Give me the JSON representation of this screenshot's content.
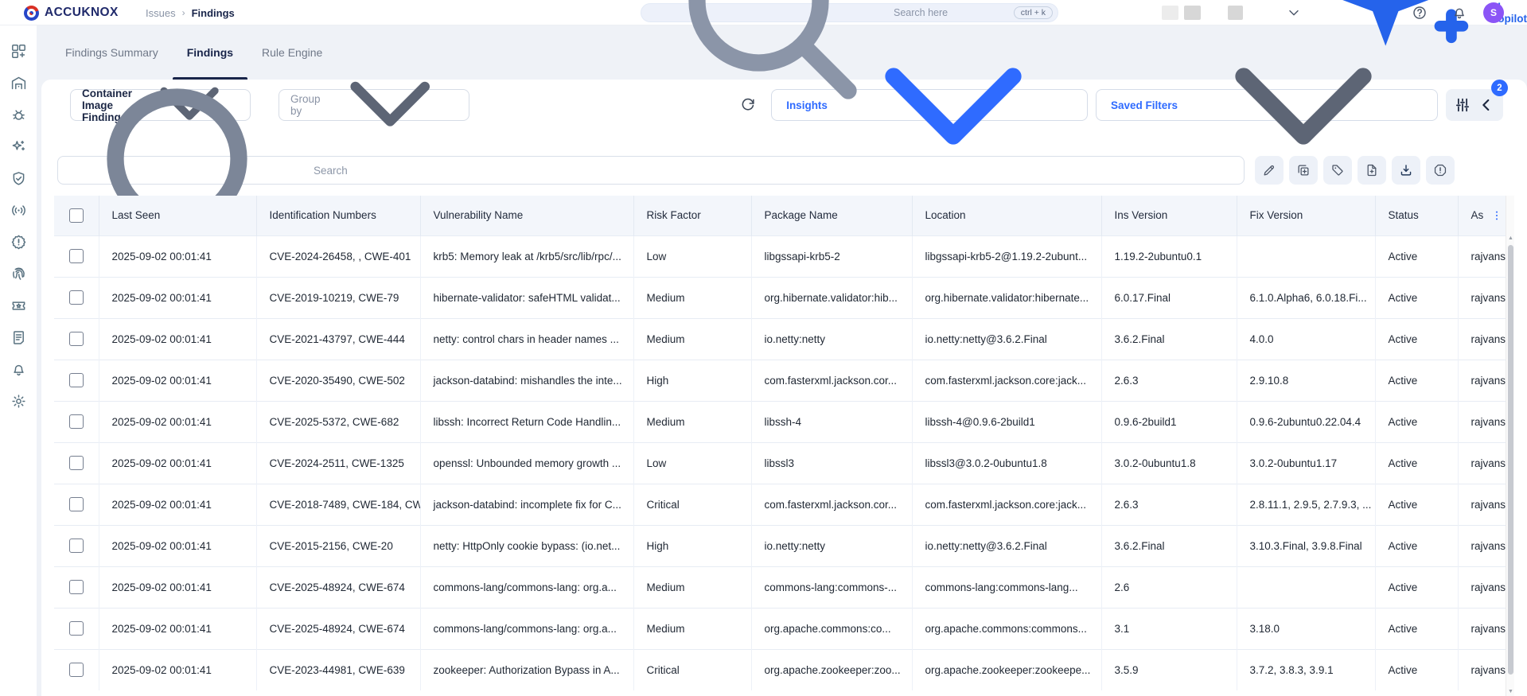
{
  "brand": {
    "name": "ACCUKNOX"
  },
  "topbar": {
    "breadcrumb": {
      "parent": "Issues",
      "separator": "›",
      "current": "Findings"
    },
    "search": {
      "placeholder": "Search here",
      "shortcut": "ctrl + k"
    },
    "copilot_label": "AI Copilot",
    "avatar_initial": "S"
  },
  "sidebar": {
    "items": [
      {
        "id": "dashboard",
        "icon": "dashboard-plus-icon"
      },
      {
        "id": "inventory",
        "icon": "warehouse-icon"
      },
      {
        "id": "issues",
        "icon": "bug-icon"
      },
      {
        "id": "remediation",
        "icon": "sparkles-icon"
      },
      {
        "id": "compliance",
        "icon": "shield-check-icon"
      },
      {
        "id": "runtime-protection",
        "icon": "broadcast-icon"
      },
      {
        "id": "alerts",
        "icon": "badge-alert-icon"
      },
      {
        "id": "identity",
        "icon": "fingerprint-icon"
      },
      {
        "id": "tickets",
        "icon": "ticket-star-icon"
      },
      {
        "id": "reports",
        "icon": "notebook-icon"
      },
      {
        "id": "notifications",
        "icon": "bell-icon"
      },
      {
        "id": "settings",
        "icon": "gear-icon"
      }
    ]
  },
  "tabs": [
    {
      "label": "Findings Summary",
      "active": false
    },
    {
      "label": "Findings",
      "active": true
    },
    {
      "label": "Rule Engine",
      "active": false
    }
  ],
  "filters": {
    "finding_type": "Container Image Findings",
    "group_by_placeholder": "Group by",
    "insights_label": "Insights",
    "saved_filters_label": "Saved Filters",
    "active_filter_count": "2"
  },
  "toolbar": {
    "search_placeholder": "Search",
    "actions": [
      {
        "id": "edit",
        "icon": "pencil-icon"
      },
      {
        "id": "duplicate",
        "icon": "copy-plus-icon"
      },
      {
        "id": "tag",
        "icon": "tag-icon"
      },
      {
        "id": "create-ticket",
        "icon": "file-plus-icon"
      },
      {
        "id": "download",
        "icon": "download-icon",
        "dark": true
      },
      {
        "id": "report-false-positive",
        "icon": "alert-octagon-icon"
      }
    ]
  },
  "table": {
    "columns": [
      "Last Seen",
      "Identification Numbers",
      "Vulnerability Name",
      "Risk Factor",
      "Package Name",
      "Location",
      "Ins Version",
      "Fix Version",
      "Status",
      "As"
    ],
    "rows": [
      [
        "2025-09-02 00:01:41",
        "CVE-2024-26458, , CWE-401",
        "krb5: Memory leak at /krb5/src/lib/rpc/...",
        "Low",
        "libgssapi-krb5-2",
        "libgssapi-krb5-2@1.19.2-2ubunt...",
        "1.19.2-2ubuntu0.1",
        "",
        "Active",
        "rajvans"
      ],
      [
        "2025-09-02 00:01:41",
        "CVE-2019-10219, CWE-79",
        "hibernate-validator: safeHTML validat...",
        "Medium",
        "org.hibernate.validator:hib...",
        "org.hibernate.validator:hibernate...",
        "6.0.17.Final",
        "6.1.0.Alpha6, 6.0.18.Fi...",
        "Active",
        "rajvans"
      ],
      [
        "2025-09-02 00:01:41",
        "CVE-2021-43797, CWE-444",
        "netty: control chars in header names ...",
        "Medium",
        "io.netty:netty",
        "io.netty:netty@3.6.2.Final",
        "3.6.2.Final",
        "4.0.0",
        "Active",
        "rajvans"
      ],
      [
        "2025-09-02 00:01:41",
        "CVE-2020-35490, CWE-502",
        "jackson-databind: mishandles the inte...",
        "High",
        "com.fasterxml.jackson.cor...",
        "com.fasterxml.jackson.core:jack...",
        "2.6.3",
        "2.9.10.8",
        "Active",
        "rajvans"
      ],
      [
        "2025-09-02 00:01:41",
        "CVE-2025-5372, CWE-682",
        "libssh: Incorrect Return Code Handlin...",
        "Medium",
        "libssh-4",
        "libssh-4@0.9.6-2build1",
        "0.9.6-2build1",
        "0.9.6-2ubuntu0.22.04.4",
        "Active",
        "rajvans"
      ],
      [
        "2025-09-02 00:01:41",
        "CVE-2024-2511, CWE-1325",
        "openssl: Unbounded memory growth ...",
        "Low",
        "libssl3",
        "libssl3@3.0.2-0ubuntu1.8",
        "3.0.2-0ubuntu1.8",
        "3.0.2-0ubuntu1.17",
        "Active",
        "rajvans"
      ],
      [
        "2025-09-02 00:01:41",
        "CVE-2018-7489, CWE-184, CW",
        "jackson-databind: incomplete fix for C...",
        "Critical",
        "com.fasterxml.jackson.cor...",
        "com.fasterxml.jackson.core:jack...",
        "2.6.3",
        "2.8.11.1, 2.9.5, 2.7.9.3, ...",
        "Active",
        "rajvans"
      ],
      [
        "2025-09-02 00:01:41",
        "CVE-2015-2156, CWE-20",
        "netty: HttpOnly cookie bypass: (io.net...",
        "High",
        "io.netty:netty",
        "io.netty:netty@3.6.2.Final",
        "3.6.2.Final",
        "3.10.3.Final, 3.9.8.Final",
        "Active",
        "rajvans"
      ],
      [
        "2025-09-02 00:01:41",
        "CVE-2025-48924, CWE-674",
        "commons-lang/commons-lang: org.a...",
        "Medium",
        "commons-lang:commons-...",
        "commons-lang:commons-lang...",
        "2.6",
        "",
        "Active",
        "rajvans"
      ],
      [
        "2025-09-02 00:01:41",
        "CVE-2025-48924, CWE-674",
        "commons-lang/commons-lang: org.a...",
        "Medium",
        "org.apache.commons:co...",
        "org.apache.commons:commons...",
        "3.1",
        "3.18.0",
        "Active",
        "rajvans"
      ],
      [
        "2025-09-02 00:01:41",
        "CVE-2023-44981, CWE-639",
        "zookeeper: Authorization Bypass in A...",
        "Critical",
        "org.apache.zookeeper:zoo...",
        "org.apache.zookeeper:zookeepe...",
        "3.5.9",
        "3.7.2, 3.8.3, 3.9.1",
        "Active",
        "rajvans"
      ]
    ]
  },
  "colors": {
    "accent": "#2f6bff",
    "navy": "#19254a",
    "avatar": "#8b55f6",
    "logo": "#202a6b"
  }
}
